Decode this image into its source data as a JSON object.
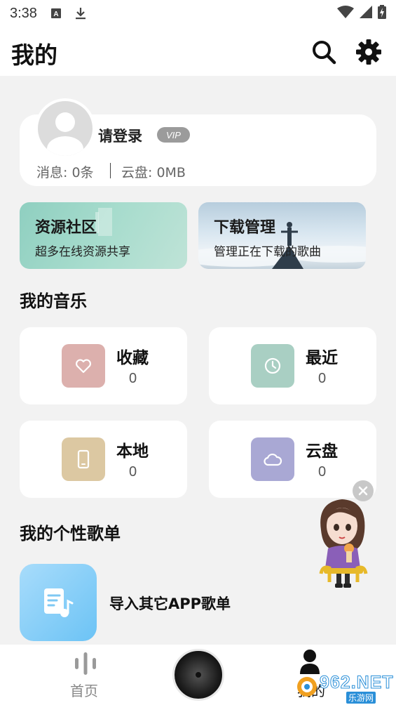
{
  "status_bar": {
    "time": "3:38"
  },
  "header": {
    "title": "我的"
  },
  "profile": {
    "login_text": "请登录",
    "vip_badge": "VIP",
    "messages": "消息: 0条",
    "cloud": "云盘: 0MB"
  },
  "banners": [
    {
      "title": "资源社区",
      "subtitle": "超多在线资源共享"
    },
    {
      "title": "下载管理",
      "subtitle": "管理正在下载的歌曲"
    }
  ],
  "my_music": {
    "heading": "我的音乐",
    "items": [
      {
        "label": "收藏",
        "count": "0",
        "icon": "heart-icon",
        "color": "#dcb0ad"
      },
      {
        "label": "最近",
        "count": "0",
        "icon": "clock-icon",
        "color": "#a9cfc3"
      },
      {
        "label": "本地",
        "count": "0",
        "icon": "phone-icon",
        "color": "#dcc8a2"
      },
      {
        "label": "云盘",
        "count": "0",
        "icon": "cloud-icon",
        "color": "#a9a8d4"
      }
    ]
  },
  "playlists": {
    "heading": "我的个性歌单",
    "import_label": "导入其它APP歌单"
  },
  "bottom_nav": {
    "home_label": "首页",
    "me_label": "我的"
  },
  "watermark": {
    "brand": "962.NET",
    "sub": "乐游网"
  }
}
